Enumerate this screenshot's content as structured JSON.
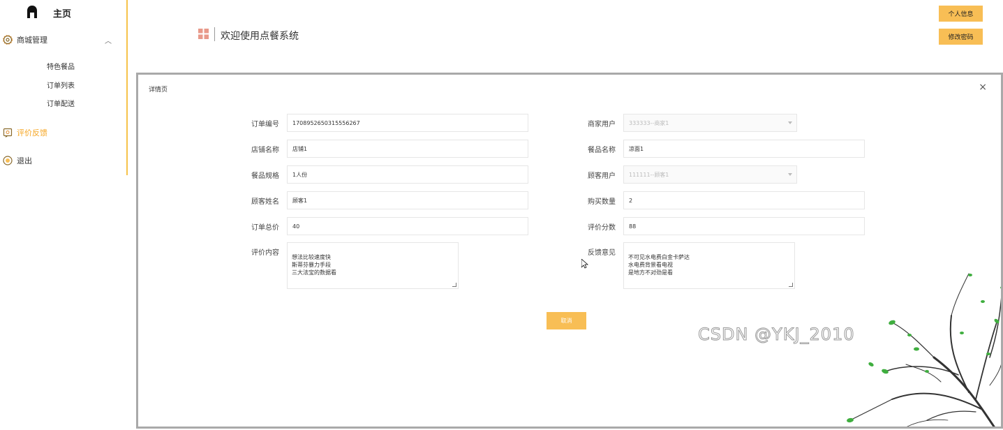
{
  "sidebar": {
    "home_label": "主页",
    "mall_label": "商城管理",
    "sub_items": [
      "特色餐品",
      "订单列表",
      "订单配送"
    ],
    "feedback_label": "评价反馈",
    "logout_label": "退出",
    "accent_color": "#f6a623"
  },
  "header": {
    "title": "欢迎使用点餐系统",
    "profile_button": "个人信息",
    "password_button": "修改密码"
  },
  "modal": {
    "title": "详情页",
    "close_symbol": "×",
    "fields": {
      "order_no_label": "订单编号",
      "order_no_value": "1708952650315556267",
      "merchant_label": "商家用户",
      "merchant_value": "333333--商家1",
      "shop_label": "店铺名称",
      "shop_value": "店铺1",
      "dish_label": "餐品名称",
      "dish_value": "凉面1",
      "spec_label": "餐品规格",
      "spec_value": "1人份",
      "customer_user_label": "顾客用户",
      "customer_user_value": "111111--顾客1",
      "customer_name_label": "顾客姓名",
      "customer_name_value": "顾客1",
      "quantity_label": "购买数量",
      "quantity_value": "2",
      "total_label": "订单总价",
      "total_value": "40",
      "score_label": "评价分数",
      "score_value": "88",
      "review_label": "评价内容",
      "review_value": "想法比较速度快\n斯蒂芬暴力手段\n三大法宝的数据看",
      "feedback_label": "反馈意见",
      "feedback_value": "不可见水电费白金卡萨达\n水电费背景看电视\n是地方不对劲是看"
    },
    "cancel_button": "取消"
  },
  "watermark": "CSDN @YKJ_2010",
  "icons": [
    "home-icon",
    "gear-icon",
    "chevron-up-icon",
    "feedback-icon",
    "logout-icon",
    "grid-icon",
    "close-icon",
    "dropdown-arrow-icon",
    "cursor-icon"
  ]
}
